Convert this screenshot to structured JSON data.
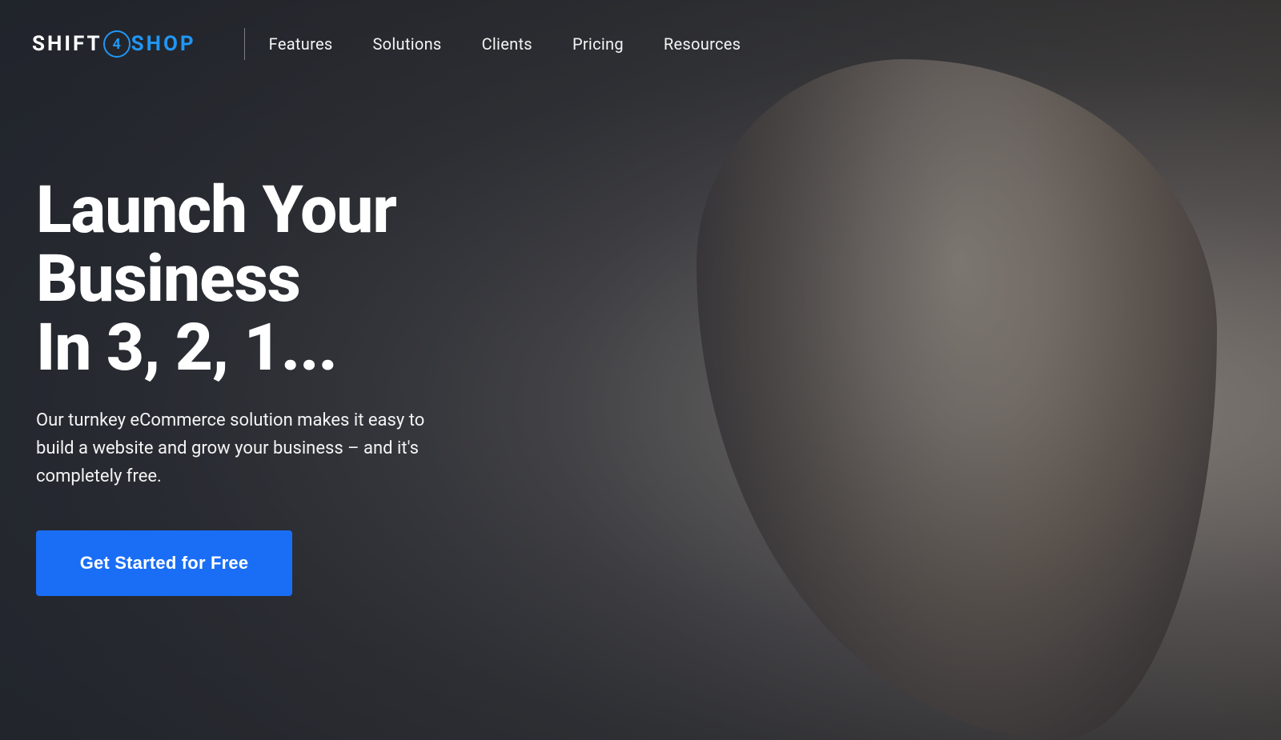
{
  "logo": {
    "shift": "SHIFT",
    "number": "4",
    "shop": "SHOP"
  },
  "nav": {
    "items": [
      {
        "label": "Features",
        "href": "#"
      },
      {
        "label": "Solutions",
        "href": "#"
      },
      {
        "label": "Clients",
        "href": "#"
      },
      {
        "label": "Pricing",
        "href": "#"
      },
      {
        "label": "Resources",
        "href": "#"
      }
    ]
  },
  "hero": {
    "heading_line1": "Launch Your Business",
    "heading_line2": "In 3, 2, 1...",
    "subtext": "Our turnkey eCommerce solution makes it easy to build a website and grow your business – and it's completely free.",
    "cta_label": "Get Started for Free"
  }
}
